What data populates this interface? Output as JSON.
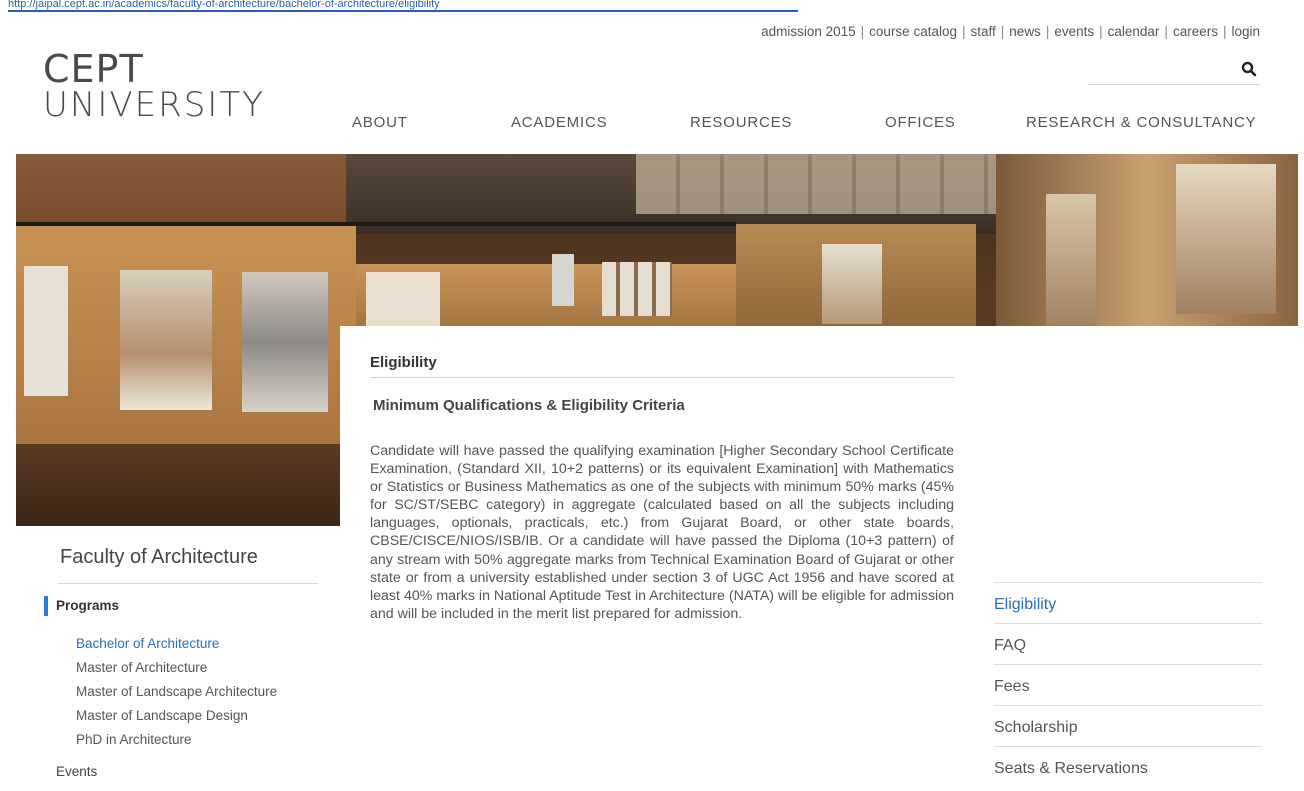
{
  "top_url": "http://jaipal.cept.ac.in/academics/faculty-of-architecture/bachelor-of-architecture/eligibility",
  "utility_nav": [
    "admission 2015",
    "course catalog",
    "staff",
    "news",
    "events",
    "calendar",
    "careers",
    "login"
  ],
  "search": {
    "placeholder": "",
    "icon": "search-icon"
  },
  "logo": {
    "line1": "CEPT",
    "line2": "UNIVERSITY"
  },
  "main_nav": [
    "ABOUT",
    "ACADEMICS",
    "RESOURCES",
    "OFFICES",
    "RESEARCH & CONSULTANCY"
  ],
  "content": {
    "title": "Eligibility",
    "subtitle": "Minimum Qualifications & Eligibility Criteria",
    "body": "Candidate will have passed the qualifying examination [Higher Secondary School Certificate Examination, (Standard XII, 10+2 patterns) or its equivalent Examination] with Mathematics or Statistics or Business Mathematics as one of the subjects with minimum 50% marks (45% for SC/ST/SEBC category) in aggregate (calculated based on all the subjects including languages, optionals, practicals, etc.) from Gujarat Board, or other state boards, CBSE/CISCE/NIOS/ISB/IB. Or a candidate will have passed the Diploma (10+3 pattern) of any stream with 50% aggregate marks from Technical Examination Board of Gujarat or other state or from a university established under section 3 of UGC Act 1956 and have scored at least 40% marks in National Aptitude Test in Architecture (NATA) will be eligible for admission and will be included in the merit list prepared for admission."
  },
  "sidebar": {
    "faculty_title": "Faculty of Architecture",
    "programs_heading": "Programs",
    "programs": [
      "Bachelor of Architecture",
      "Master of Architecture",
      "Master of Landscape Architecture",
      "Master of Landscape Design",
      "PhD in Architecture"
    ],
    "events_label": "Events"
  },
  "side_nav": [
    "Eligibility",
    "FAQ",
    "Fees",
    "Scholarship",
    "Seats & Reservations"
  ],
  "colors": {
    "link_blue": "#2a6db8",
    "accent_bar": "#2a7bd1",
    "text": "#555555"
  }
}
